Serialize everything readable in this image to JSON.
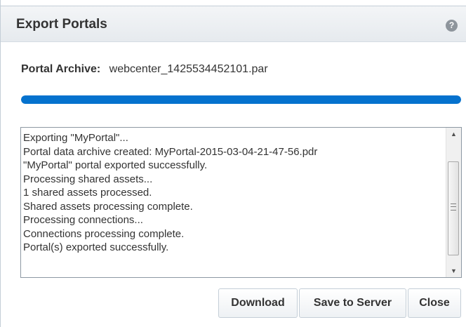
{
  "dialog": {
    "title": "Export Portals",
    "help_glyph": "?",
    "help_icon": "help-icon"
  },
  "archive": {
    "label": "Portal Archive:",
    "value": "webcenter_1425534452101.par"
  },
  "progress": {
    "fraction": 1.0,
    "color": "#0572ce"
  },
  "log": {
    "lines": [
      "Exporting \"MyPortal\"...",
      "Portal data archive created: MyPortal-2015-03-04-21-47-56.pdr",
      "\"MyPortal\" portal exported successfully.",
      "Processing shared assets...",
      "1 shared assets processed.",
      "Shared assets processing complete.",
      "Processing connections...",
      "Connections processing complete.",
      "Portal(s) exported successfully."
    ],
    "scroll_up_glyph": "▲",
    "scroll_down_glyph": "▼"
  },
  "buttons": {
    "download": "Download",
    "save_to_server": "Save to Server",
    "close": "Close"
  }
}
